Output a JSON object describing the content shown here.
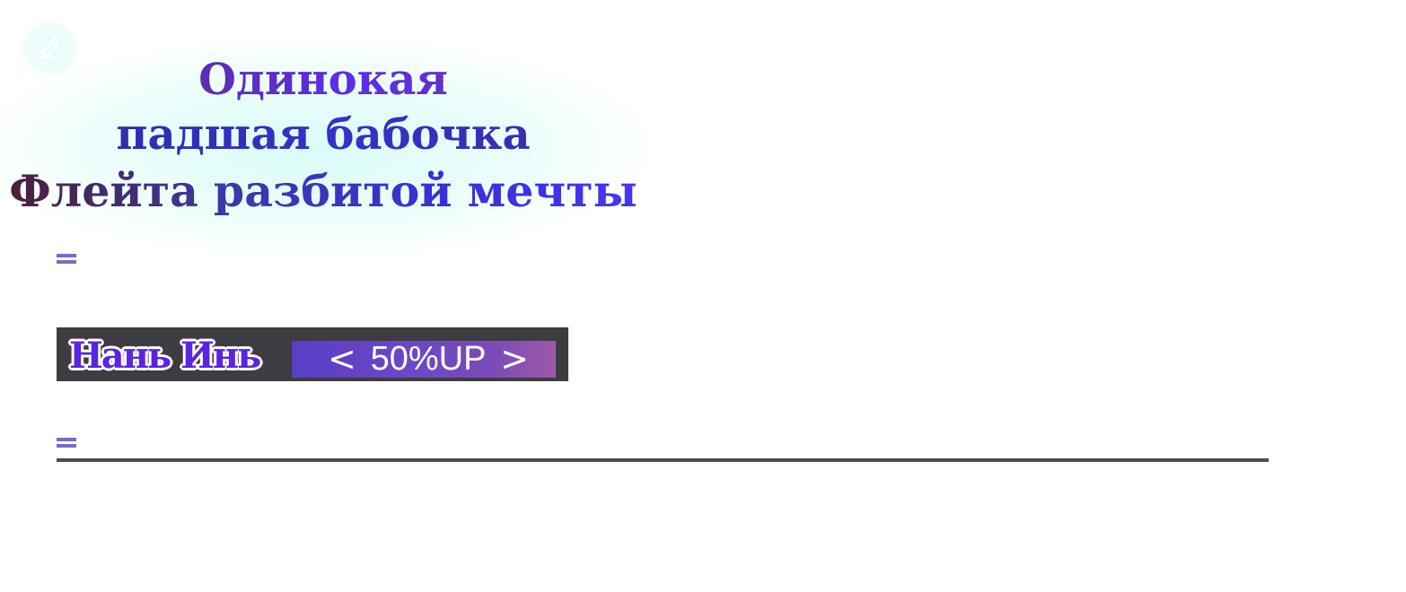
{
  "title": {
    "line1": "Одинокая",
    "line2": "падшая бабочка",
    "line3": "Флейта разбитой мечты"
  },
  "logo": {
    "icon": "brush-logo-icon"
  },
  "menu": {
    "icon": "menu-lines-icon"
  },
  "banner": {
    "name": "Нань Инь",
    "left_arrow": "<",
    "promo": "50%UP",
    "right_arrow": ">"
  },
  "colors": {
    "accent": "#5b2ee8",
    "menu_icon": "#7a6ac8",
    "banner_bg": "#3d3c42",
    "rule": "#4d4b55"
  }
}
